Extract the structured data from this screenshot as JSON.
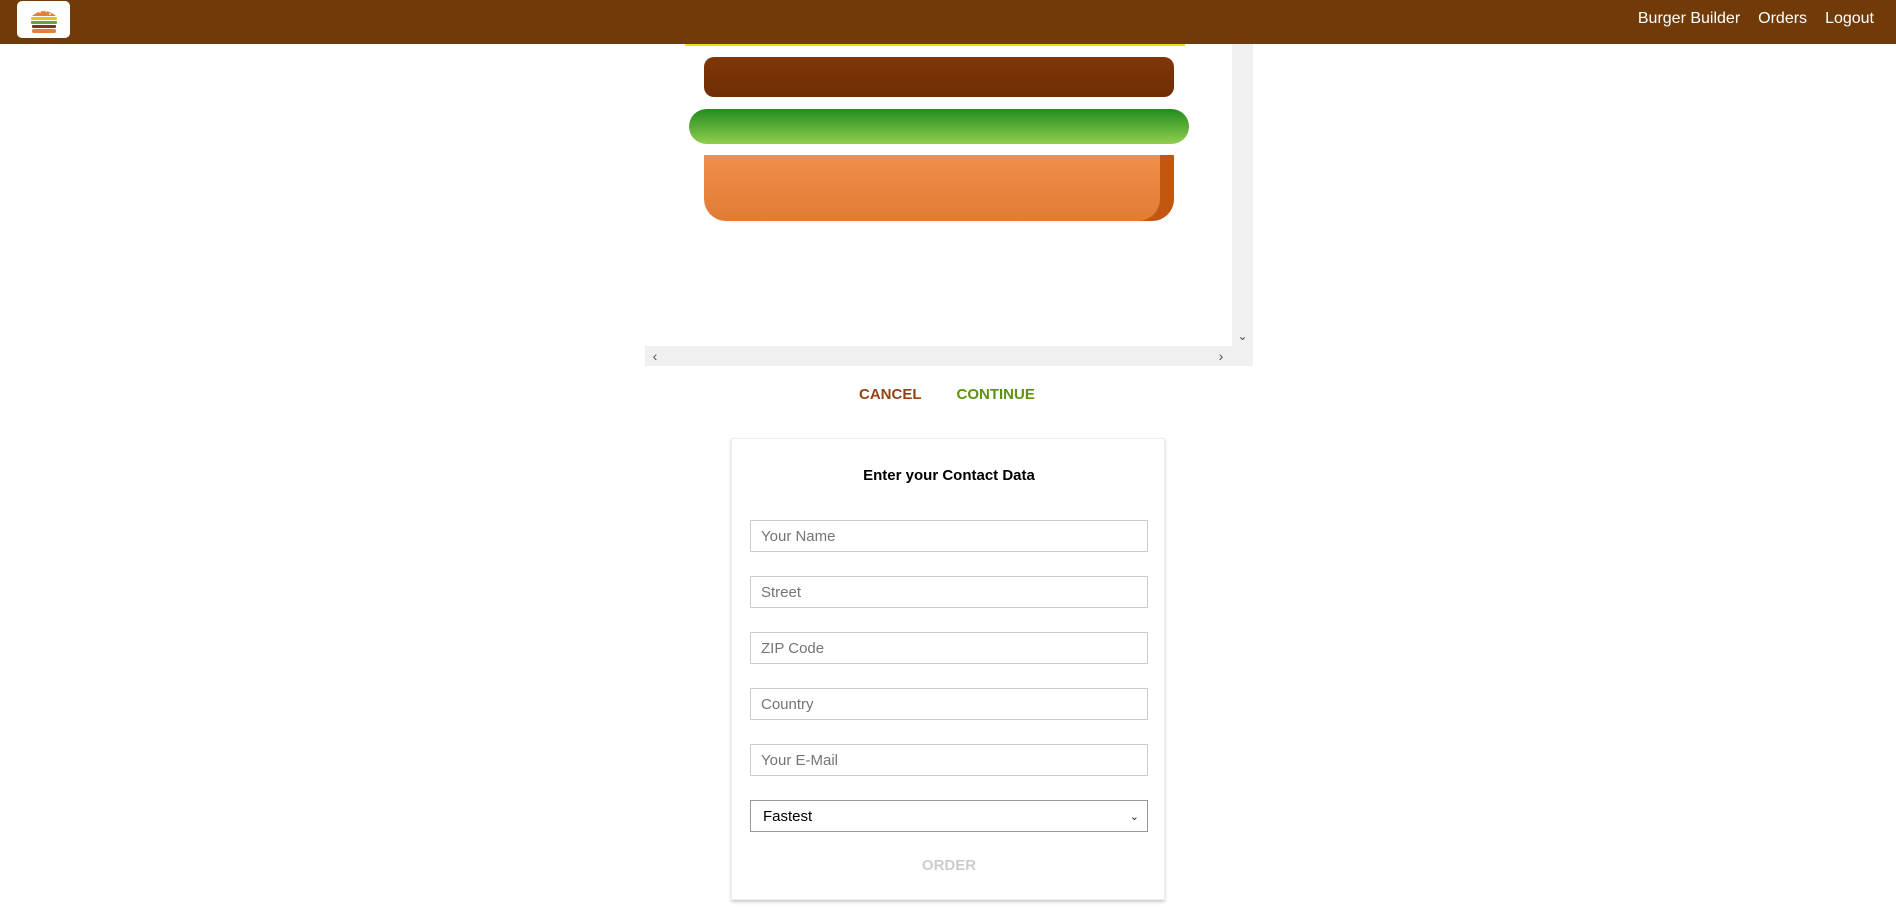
{
  "header": {
    "logo_icon": "burger-logo-icon",
    "nav": [
      {
        "label": "Burger Builder"
      },
      {
        "label": "Orders"
      },
      {
        "label": "Logout"
      }
    ]
  },
  "burger": {
    "layers": [
      "meat",
      "salad",
      "bread-bottom"
    ],
    "colors": {
      "meat": "#7f3608",
      "salad": "#228c1d",
      "bread": "#F08E4A",
      "bread_edge": "#c15711",
      "seeds": "#E7E300"
    }
  },
  "actions": {
    "cancel_label": "CANCEL",
    "continue_label": "CONTINUE"
  },
  "contact": {
    "title": "Enter your Contact Data",
    "fields": [
      {
        "placeholder": "Your Name",
        "value": ""
      },
      {
        "placeholder": "Street",
        "value": ""
      },
      {
        "placeholder": "ZIP Code",
        "value": ""
      },
      {
        "placeholder": "Country",
        "value": ""
      },
      {
        "placeholder": "Your E-Mail",
        "value": ""
      }
    ],
    "delivery_method": "Fastest",
    "order_label": "ORDER"
  },
  "colors": {
    "topbar": "#703B09",
    "cancel": "#944317",
    "continue": "#5C9210",
    "disabled": "#cccccc"
  }
}
